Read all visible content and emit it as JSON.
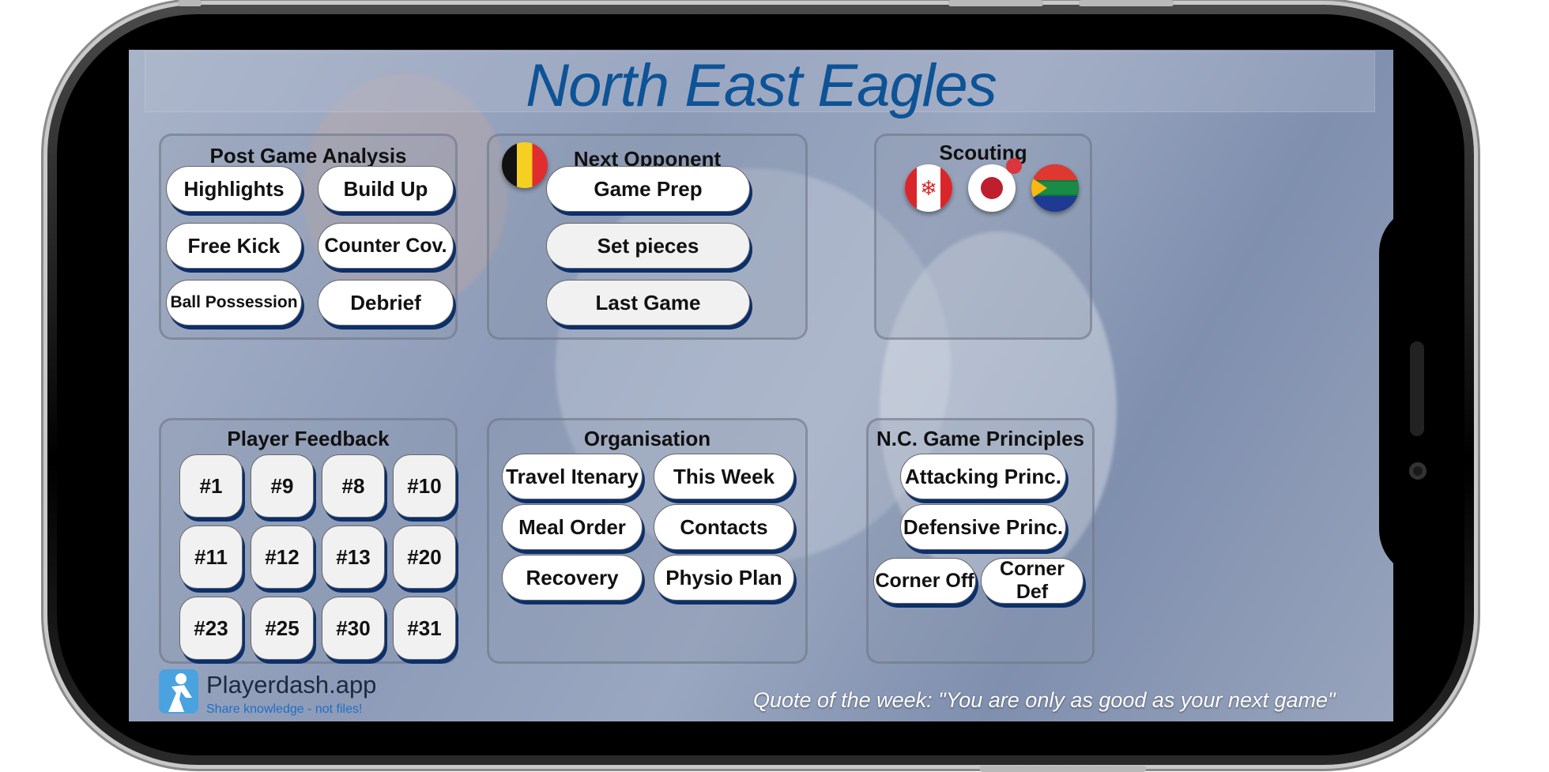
{
  "title": "North East Eagles",
  "post_game": {
    "title": "Post Game Analysis",
    "buttons": [
      "Highlights",
      "Build Up",
      "Free Kick",
      "Counter Cov.",
      "Ball Possession",
      "Debrief"
    ]
  },
  "next_opponent": {
    "title": "Next Opponent",
    "flag": "belgium-flag",
    "buttons": [
      "Game Prep",
      "Set pieces",
      "Last Game"
    ]
  },
  "scouting": {
    "title": "Scouting",
    "flags": [
      "canada-flag",
      "japan-flag",
      "south-africa-flag"
    ]
  },
  "player_feedback": {
    "title": "Player Feedback",
    "players": [
      "#1",
      "#9",
      "#8",
      "#10",
      "#11",
      "#12",
      "#13",
      "#20",
      "#23",
      "#25",
      "#30",
      "#31"
    ]
  },
  "organisation": {
    "title": "Organisation",
    "buttons": [
      "Travel Itenary",
      "This Week",
      "Meal Order",
      "Contacts",
      "Recovery",
      "Physio Plan"
    ]
  },
  "game_principles": {
    "title": "N.C. Game Principles",
    "buttons": [
      "Attacking Princ.",
      "Defensive Princ.",
      "Corner Off",
      "Corner Def"
    ]
  },
  "logo": {
    "name": "Playerdash.app",
    "tagline": "Share knowledge - not files!"
  },
  "quote": "Quote of the week: \"You are only as good as your next game\"",
  "colors": {
    "title": "#0d5396",
    "button_shadow": "#0b2f6a",
    "notification_dot": "#d9363e"
  }
}
